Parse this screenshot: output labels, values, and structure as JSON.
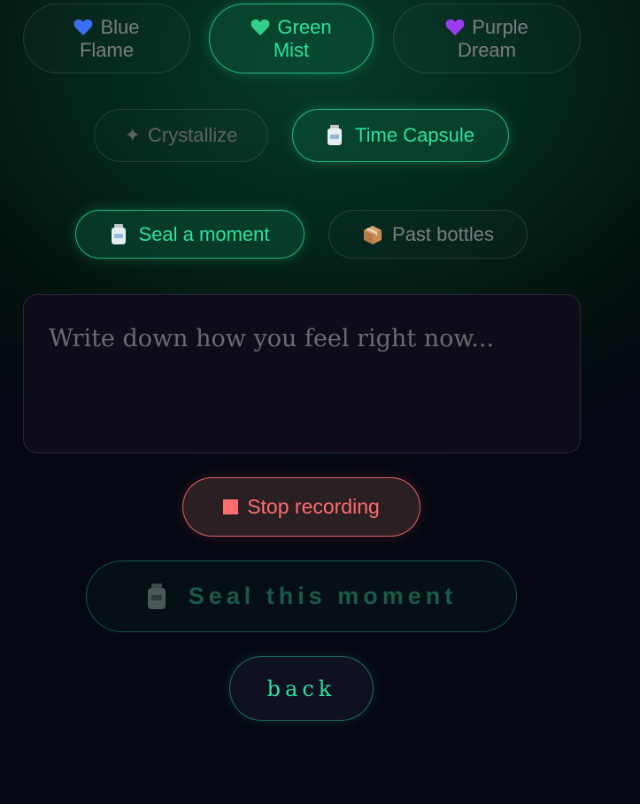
{
  "themes": [
    {
      "line1": "Blue",
      "line2": "Flame",
      "icon": "blue-heart-icon",
      "color": "#3b6ef0",
      "active": false
    },
    {
      "line1": "Green",
      "line2": "Mist",
      "icon": "green-heart-icon",
      "color": "#33d08a",
      "active": true
    },
    {
      "line1": "Purple",
      "line2": "Dream",
      "icon": "purple-heart-icon",
      "color": "#9b3cf0",
      "active": false
    }
  ],
  "modes": [
    {
      "label": "Crystallize",
      "icon": "sparkle-icon",
      "glyph": "✦",
      "active": false
    },
    {
      "label": "Time Capsule",
      "icon": "jar-icon",
      "active": true
    }
  ],
  "tabs": [
    {
      "label": "Seal a moment",
      "icon": "jar-icon",
      "active": true
    },
    {
      "label": "Past bottles",
      "icon": "package-icon",
      "active": false
    }
  ],
  "entry": {
    "placeholder": "Write down how you feel right now...",
    "value": ""
  },
  "recording": {
    "stop_label": "Stop recording",
    "icon": "stop-square-icon"
  },
  "seal_button": {
    "label": "Seal this moment",
    "icon": "jar-icon"
  },
  "back_button": {
    "label": "back"
  },
  "colors": {
    "accent": "#2fe0a0",
    "danger": "#ff6e6e",
    "muted": "#7a7f80"
  }
}
